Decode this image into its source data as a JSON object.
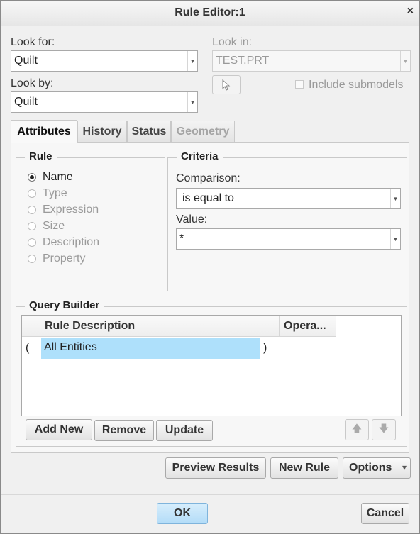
{
  "window": {
    "title": "Rule Editor:1",
    "close_glyph": "×"
  },
  "look_for": {
    "label": "Look for:",
    "value": "Quilt"
  },
  "look_by": {
    "label": "Look by:",
    "value": "Quilt"
  },
  "look_in": {
    "label": "Look in:",
    "value": "TEST.PRT",
    "include_submodels_label": "Include submodels",
    "include_submodels_checked": false
  },
  "tabs": [
    {
      "label": "Attributes",
      "active": true,
      "enabled": true
    },
    {
      "label": "History",
      "active": false,
      "enabled": true
    },
    {
      "label": "Status",
      "active": false,
      "enabled": true
    },
    {
      "label": "Geometry",
      "active": false,
      "enabled": false
    }
  ],
  "rule_group": {
    "title": "Rule",
    "options": [
      {
        "label": "Name",
        "checked": true,
        "enabled": true
      },
      {
        "label": "Type",
        "checked": false,
        "enabled": false
      },
      {
        "label": "Expression",
        "checked": false,
        "enabled": false
      },
      {
        "label": "Size",
        "checked": false,
        "enabled": false
      },
      {
        "label": "Description",
        "checked": false,
        "enabled": false
      },
      {
        "label": "Property",
        "checked": false,
        "enabled": false
      }
    ]
  },
  "criteria": {
    "title": "Criteria",
    "comparison_label": "Comparison:",
    "comparison_value": "is equal to",
    "value_label": "Value:",
    "value_value": "*"
  },
  "query_builder": {
    "title": "Query Builder",
    "columns": [
      "Rule Description",
      "Opera..."
    ],
    "rows": [
      {
        "open": "(",
        "description": "All Entities",
        "close": ")"
      }
    ],
    "add_new_label": "Add New",
    "remove_label": "Remove",
    "update_label": "Update",
    "move_up_glyph": "🡅",
    "move_down_glyph": "🡇"
  },
  "actions": {
    "preview_results_label": "Preview Results",
    "new_rule_label": "New Rule",
    "options_label": "Options",
    "options_arrow": "▾"
  },
  "footer": {
    "ok_label": "OK",
    "cancel_label": "Cancel"
  },
  "colors": {
    "selection": "#aee0fb",
    "ok_button": "#bfe3fb"
  }
}
